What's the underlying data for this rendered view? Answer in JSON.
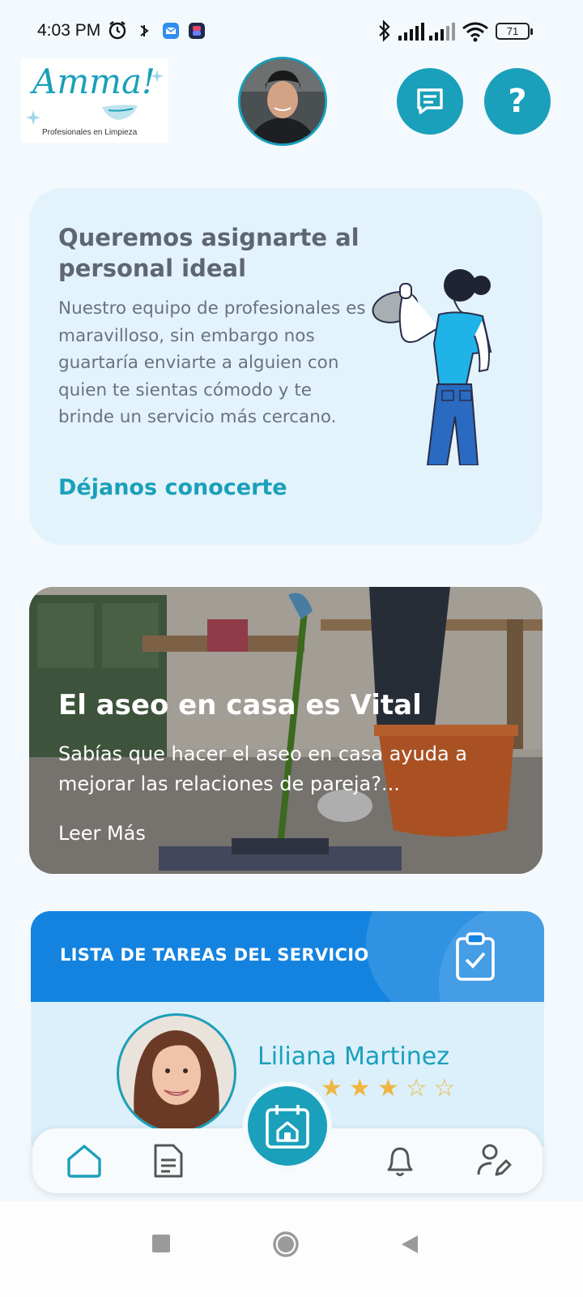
{
  "status_bar": {
    "time": "4:03 PM",
    "battery": "71"
  },
  "header": {
    "logo_text": "Amma!",
    "logo_tagline": "Profesionales en Limpieza",
    "help_label": "?"
  },
  "promo": {
    "title": "Queremos asignarte al personal ideal",
    "body": "Nuestro equipo de profesionales es  maravilloso, sin embargo nos guartaría enviarte a alguien con quien te sientas cómodo y te brinde un servicio más cercano.",
    "link": "Déjanos conocerte"
  },
  "article": {
    "title": "El aseo en casa es Vital",
    "description": "Sabías que hacer el aseo en casa ayuda a mejorar las relaciones de pareja?...",
    "read_more": "Leer Más"
  },
  "task_card": {
    "title": "LISTA DE TAREAS DEL SERVICIO",
    "worker_name": "Liliana Martinez",
    "rating": 3,
    "rating_max": 5
  },
  "bottom_nav": {
    "items": [
      {
        "icon": "home-icon",
        "active": true
      },
      {
        "icon": "document-icon",
        "active": false
      },
      {
        "icon": "calendar-home-icon",
        "active": false
      },
      {
        "icon": "bell-icon",
        "active": false
      },
      {
        "icon": "user-edit-icon",
        "active": false
      }
    ]
  },
  "colors": {
    "accent": "#1aa0ba",
    "promo_bg": "#e3f3fc",
    "task_header": "#1483e0",
    "star": "#efb541"
  }
}
